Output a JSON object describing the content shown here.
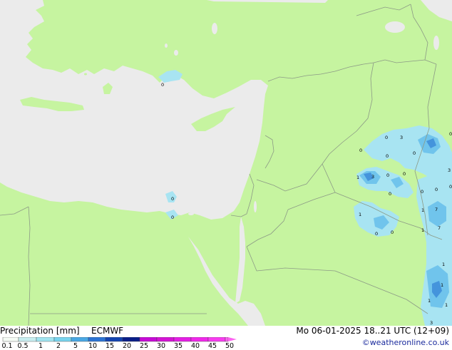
{
  "footer": {
    "title": "Precipitation [mm]",
    "model": "ECMWF",
    "datetime": "Mo 06-01-2025 18..21 UTC (12+09)",
    "credit": "©weatheronline.co.uk"
  },
  "legend": {
    "ticks": [
      "0.1",
      "0.5",
      "1",
      "2",
      "5",
      "10",
      "15",
      "20",
      "25",
      "30",
      "35",
      "40",
      "45",
      "50"
    ],
    "colors": [
      "#f5fbf5",
      "#c8eef0",
      "#a0e4f0",
      "#78d4ee",
      "#4aa8e4",
      "#2c74d4",
      "#1444b0",
      "#0a1e88",
      "#c60ad6",
      "#d414d4",
      "#e41ee4",
      "#f028ea",
      "#f83cf0",
      "#fc64f0"
    ]
  },
  "map": {
    "colors": {
      "land": "#c6f4a0",
      "sea": "#ebebeb",
      "border": "#8c9a86",
      "precip_light": "#a8e4f2",
      "precip_mid": "#70c4ec",
      "precip_heavy": "#4494dc"
    },
    "precip_labels": [
      {
        "id": "lbl-1",
        "text": "0"
      },
      {
        "id": "lbl-2",
        "text": "0"
      },
      {
        "id": "lbl-3",
        "text": "0"
      },
      {
        "id": "lbl-4",
        "text": "0"
      },
      {
        "id": "lbl-5",
        "text": "3"
      },
      {
        "id": "lbl-6",
        "text": "0"
      },
      {
        "id": "lbl-7",
        "text": "0"
      },
      {
        "id": "lbl-8",
        "text": "0"
      },
      {
        "id": "lbl-9",
        "text": "1"
      },
      {
        "id": "lbl-10",
        "text": "3"
      },
      {
        "id": "lbl-11",
        "text": "0"
      },
      {
        "id": "lbl-12",
        "text": "0"
      },
      {
        "id": "lbl-13",
        "text": "0"
      },
      {
        "id": "lbl-14",
        "text": "3"
      },
      {
        "id": "lbl-15",
        "text": "0"
      },
      {
        "id": "lbl-16",
        "text": "0"
      },
      {
        "id": "lbl-17",
        "text": "0"
      },
      {
        "id": "lbl-18",
        "text": "7"
      },
      {
        "id": "lbl-19",
        "text": "1"
      },
      {
        "id": "lbl-20",
        "text": "0"
      },
      {
        "id": "lbl-21",
        "text": "0"
      },
      {
        "id": "lbl-22",
        "text": "1"
      },
      {
        "id": "lbl-23",
        "text": "7"
      },
      {
        "id": "lbl-24",
        "text": "1"
      },
      {
        "id": "lbl-25",
        "text": "1"
      },
      {
        "id": "lbl-26",
        "text": "1"
      },
      {
        "id": "lbl-27",
        "text": "1"
      },
      {
        "id": "lbl-28",
        "text": "1"
      },
      {
        "id": "lbl-29",
        "text": "3"
      },
      {
        "id": "lbl-30",
        "text": "0"
      }
    ]
  }
}
